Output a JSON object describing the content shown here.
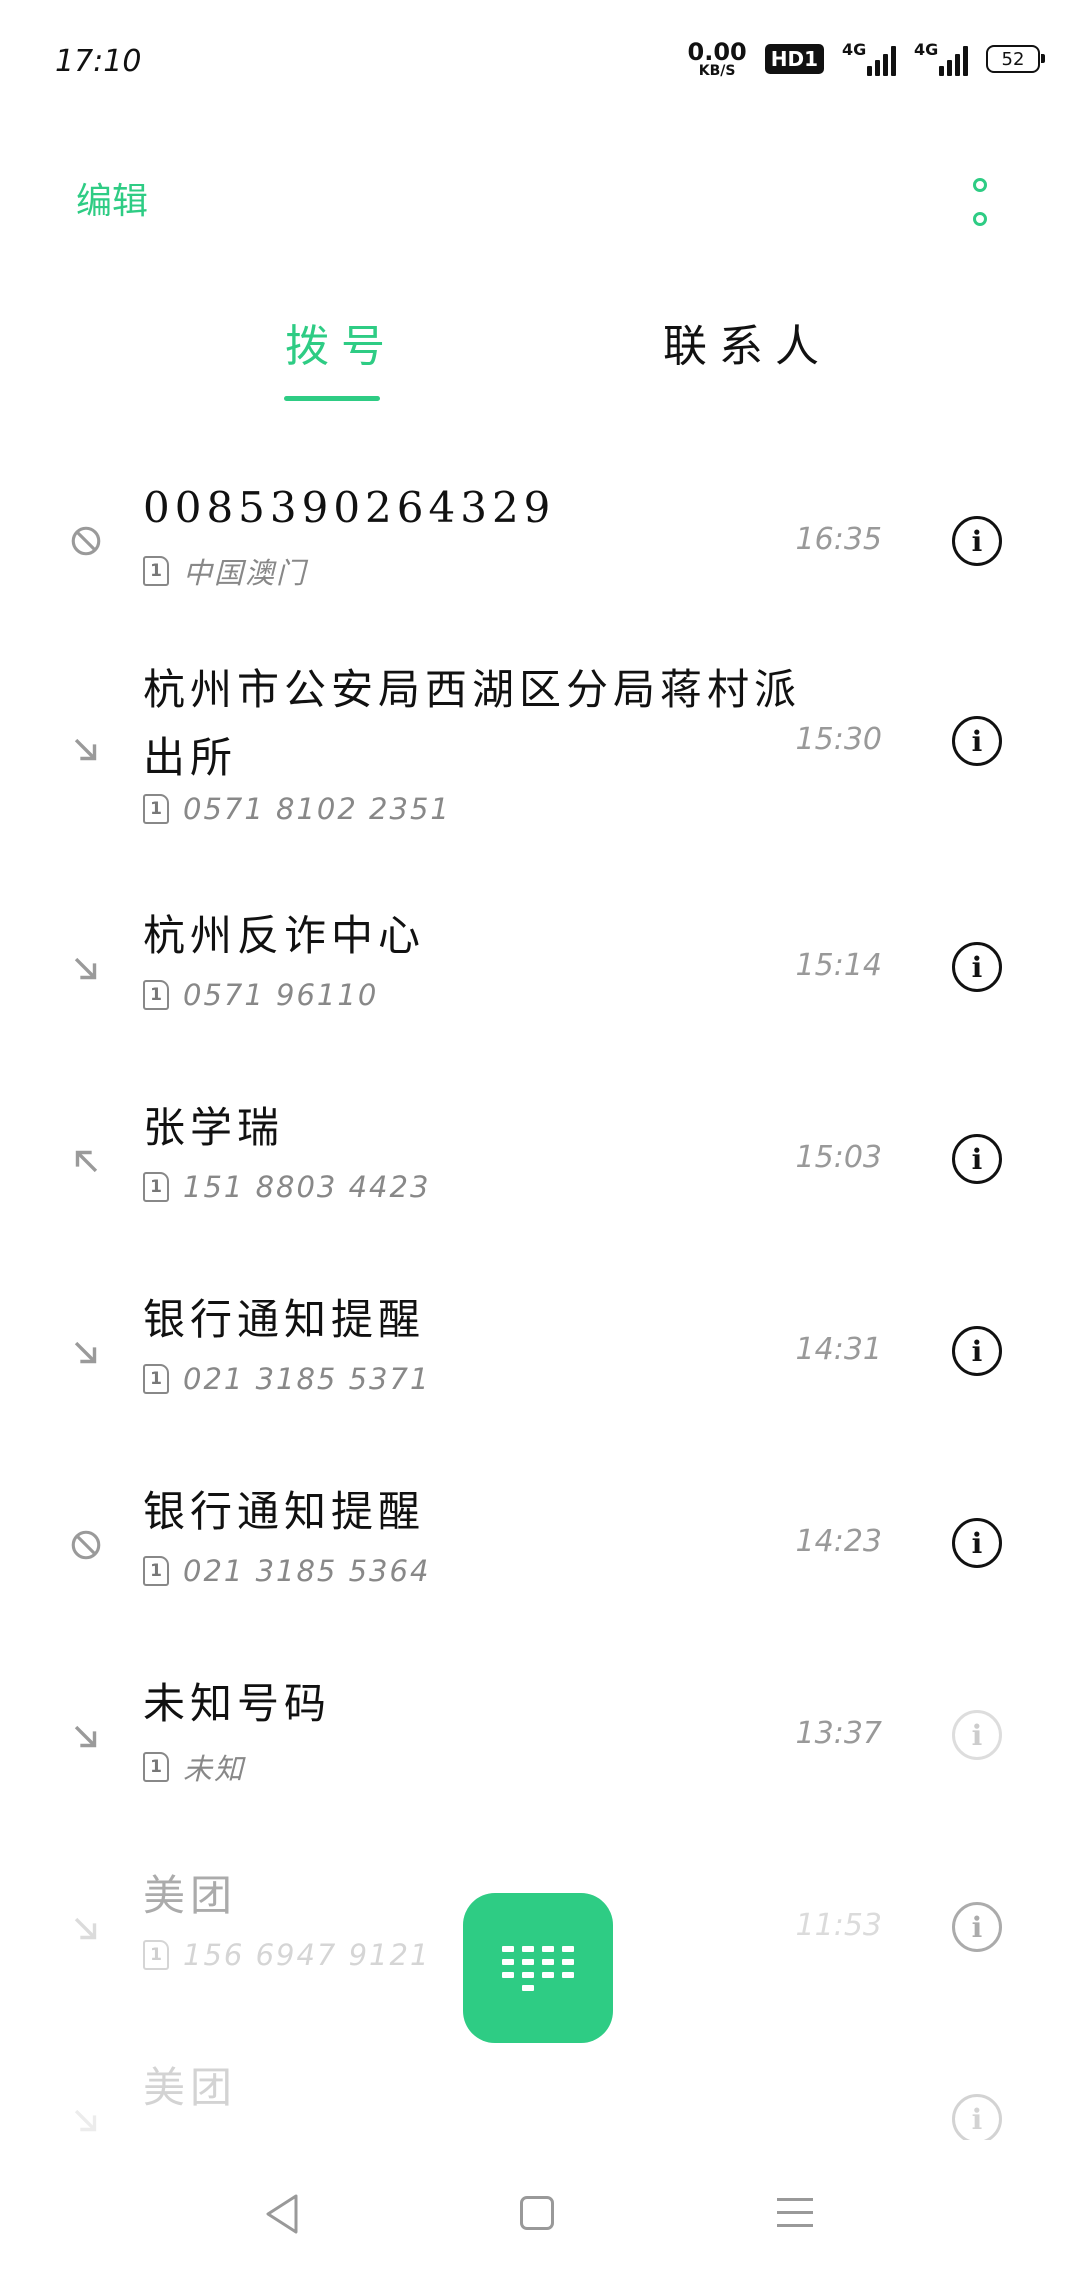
{
  "status_bar": {
    "time": "17:10",
    "net_speed": "0.00",
    "net_unit": "KB/S",
    "hd": "HD1",
    "sim1_network": "4G",
    "sim2_network": "4G",
    "battery": "52"
  },
  "header": {
    "edit_label": "编辑",
    "more_icon": "more-vertical-icon"
  },
  "tabs": [
    {
      "label": "拨号",
      "active": true
    },
    {
      "label": "联系人",
      "active": false
    }
  ],
  "calls": [
    {
      "name": "0085390264329",
      "sub": "中国澳门",
      "time": "16:35",
      "type": "blocked"
    },
    {
      "name": "杭州市公安局西湖区分局蒋村派出所",
      "sub": "0571 8102 2351",
      "time": "15:30",
      "type": "incoming"
    },
    {
      "name": "杭州反诈中心",
      "sub": "0571 96110",
      "time": "15:14",
      "type": "incoming"
    },
    {
      "name": "张学瑞",
      "sub": "151 8803 4423",
      "time": "15:03",
      "type": "outgoing"
    },
    {
      "name": "银行通知提醒",
      "sub": "021 3185 5371",
      "time": "14:31",
      "type": "incoming"
    },
    {
      "name": "银行通知提醒",
      "sub": "021 3185 5364",
      "time": "14:23",
      "type": "blocked"
    },
    {
      "name": "未知号码",
      "sub": "未知",
      "time": "13:37",
      "type": "incoming"
    },
    {
      "name": "美团",
      "sub": "156 6947 9121",
      "time": "11:53",
      "type": "incoming"
    },
    {
      "name": "美团",
      "sub": "",
      "time": "",
      "type": "incoming"
    }
  ],
  "sim_slot": "1",
  "info_glyph": "i",
  "fab": {
    "icon": "dialpad-icon",
    "color": "#2ecc84"
  },
  "nav": {
    "back": "back-icon",
    "home": "home-icon",
    "menu": "menu-icon"
  },
  "colors": {
    "accent": "#2ecc84"
  }
}
